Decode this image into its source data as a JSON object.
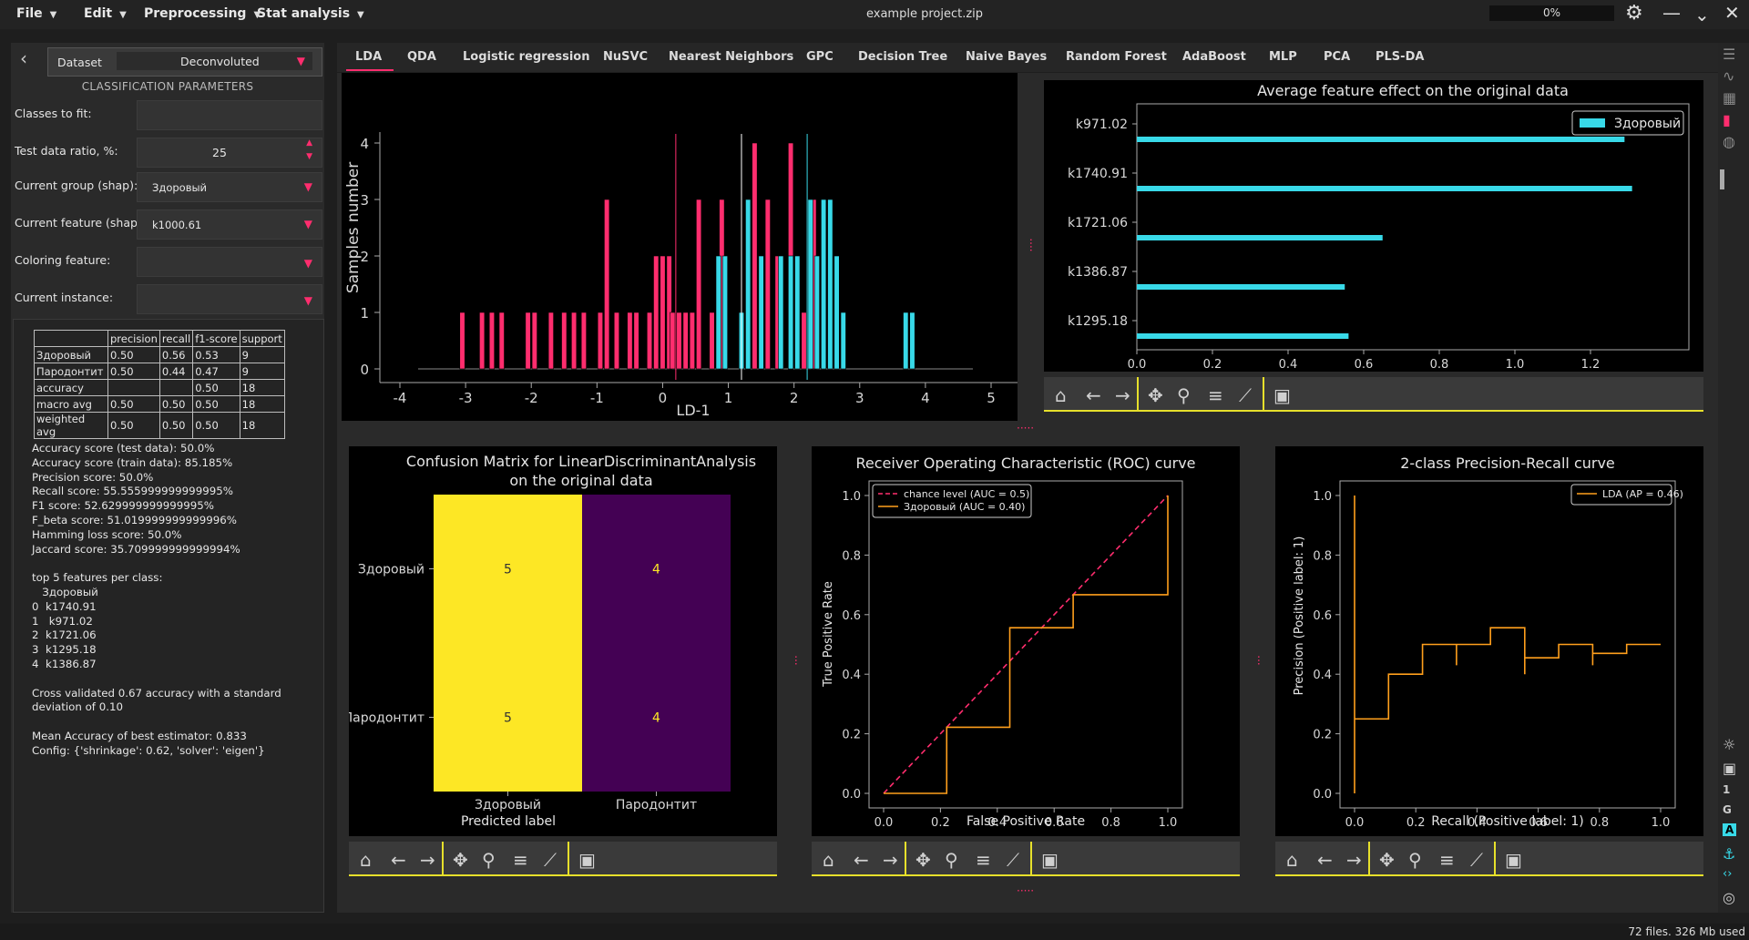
{
  "menu": {
    "file": "File",
    "edit": "Edit",
    "preprocessing": "Preprocessing",
    "stat": "Stat analysis"
  },
  "window_title": "example project.zip",
  "progress": "0%",
  "dataset": {
    "label": "Dataset",
    "value": "Deconvoluted"
  },
  "params_title": "CLASSIFICATION PARAMETERS",
  "params": [
    {
      "label": "Classes to fit:",
      "value": ""
    },
    {
      "label": "Test data ratio, %:",
      "value": "25"
    },
    {
      "label": "Current group (shap):",
      "value": "Здоровый"
    },
    {
      "label": "Current feature (shap):",
      "value": "k1000.61"
    },
    {
      "label": "Coloring feature:",
      "value": ""
    },
    {
      "label": "Current instance:",
      "value": ""
    }
  ],
  "report": {
    "header": [
      "",
      "precision",
      "recall",
      "f1-score",
      "support"
    ],
    "rows": [
      [
        "Здоровый",
        "0.50",
        "0.56",
        "0.53",
        "9"
      ],
      [
        "Пародонтит",
        "0.50",
        "0.44",
        "0.47",
        "9"
      ],
      [
        "accuracy",
        "",
        "",
        "0.50",
        "18"
      ],
      [
        " macro avg",
        "0.50",
        "0.50",
        "0.50",
        "18"
      ],
      [
        "weighted avg",
        "0.50",
        "0.50",
        "0.50",
        "18"
      ]
    ]
  },
  "metrics_text": "Accuracy score (test data): 50.0%\nAccuracy score (train data): 85.185%\nPrecision score: 50.0%\nRecall score: 55.555999999999995%\nF1 score: 52.629999999999995%\nF_beta score: 51.019999999999996%\nHamming loss score: 50.0%\nJaccard score: 35.709999999999994%\n\ntop 5 features per class:\n   Здоровый\n0  k1740.91\n1   k971.02\n2  k1721.06\n3  k1295.18\n4  k1386.87\n\nCross validated 0.67 accuracy with a standard\ndeviation of 0.10\n\nMean Accuracy of best estimator: 0.833\nConfig: {'shrinkage': 0.62, 'solver': 'eigen'}",
  "tabs": [
    "LDA",
    "QDA",
    "Logistic regression",
    "NuSVC",
    "Nearest Neighbors",
    "GPC",
    "Decision Tree",
    "Naive Bayes",
    "Random Forest",
    "AdaBoost",
    "MLP",
    "PCA",
    "PLS-DA"
  ],
  "status": "72 files. 326 Mb used",
  "colors": {
    "accent": "#ff2d6e",
    "pink": "#ff2d6e",
    "cyan": "#38d9e8",
    "yellow": "#fde725",
    "purple": "#440154",
    "orange": "#ff9f1c",
    "toolbar_line": "#e7e02b"
  },
  "toolbar_icons": [
    "home-icon",
    "back-arrow-icon",
    "forward-arrow-icon",
    "pan-icon",
    "zoom-icon",
    "configure-icon",
    "edit-axis-icon",
    "save-icon"
  ],
  "chart_data": [
    {
      "type": "bar",
      "title": "",
      "xlabel": "LD-1",
      "ylabel": "Samples number",
      "xlim": [
        -4,
        5
      ],
      "ylim": [
        0,
        4
      ],
      "xticks": [
        "-4",
        "-3",
        "-2",
        "-1",
        "0",
        "1",
        "2",
        "3",
        "4",
        "5"
      ],
      "yticks": [
        "0",
        "1",
        "2",
        "3",
        "4"
      ],
      "series": [
        {
          "color": "#ff2d6e",
          "bins": [
            [
              -3.05,
              1
            ],
            [
              -2.75,
              1
            ],
            [
              -2.6,
              1
            ],
            [
              -2.45,
              1
            ],
            [
              -2.05,
              1
            ],
            [
              -1.95,
              1
            ],
            [
              -1.7,
              1
            ],
            [
              -1.5,
              1
            ],
            [
              -1.35,
              1
            ],
            [
              -1.2,
              1
            ],
            [
              -0.95,
              1
            ],
            [
              -0.85,
              3
            ],
            [
              -0.7,
              1
            ],
            [
              -0.5,
              1
            ],
            [
              -0.4,
              1
            ],
            [
              -0.2,
              1
            ],
            [
              -0.1,
              2
            ],
            [
              0.0,
              2
            ],
            [
              0.1,
              2
            ],
            [
              0.15,
              1
            ],
            [
              0.25,
              1
            ],
            [
              0.35,
              1
            ],
            [
              0.45,
              1
            ],
            [
              0.55,
              3
            ],
            [
              0.75,
              1
            ],
            [
              0.9,
              3
            ],
            [
              1.3,
              2
            ],
            [
              1.4,
              4
            ],
            [
              1.5,
              1
            ],
            [
              1.6,
              3
            ],
            [
              1.75,
              2
            ],
            [
              1.95,
              4
            ],
            [
              2.15,
              1
            ],
            [
              2.3,
              3
            ]
          ]
        },
        {
          "color": "#38d9e8",
          "bins": [
            [
              0.85,
              2
            ],
            [
              0.95,
              2
            ],
            [
              1.2,
              1
            ],
            [
              1.3,
              3
            ],
            [
              1.5,
              2
            ],
            [
              1.8,
              2
            ],
            [
              1.95,
              2
            ],
            [
              2.05,
              2
            ],
            [
              2.25,
              3
            ],
            [
              2.35,
              2
            ],
            [
              2.45,
              3
            ],
            [
              2.55,
              3
            ],
            [
              2.65,
              2
            ],
            [
              2.75,
              1
            ],
            [
              3.7,
              1
            ],
            [
              3.8,
              1
            ]
          ]
        }
      ],
      "vlines": [
        {
          "x": 0.2,
          "color": "#ff2d6e"
        },
        {
          "x": 1.2,
          "color": "#ffffff"
        },
        {
          "x": 2.2,
          "color": "#38d9e8"
        }
      ]
    },
    {
      "type": "bar",
      "orientation": "horizontal",
      "title": "Average feature effect on the original data",
      "categories": [
        "k971.02",
        "k1740.91",
        "k1721.06",
        "k1386.87",
        "k1295.18"
      ],
      "values": [
        1.29,
        1.31,
        0.65,
        0.55,
        0.56
      ],
      "xlim": [
        0,
        1.4
      ],
      "xticks": [
        "0.0",
        "0.2",
        "0.4",
        "0.6",
        "0.8",
        "1.0",
        "1.2"
      ],
      "legend": "Здоровый",
      "legend_position": "top-right"
    },
    {
      "type": "heatmap",
      "title": "Confusion Matrix for LinearDiscriminantAnalysis\non the original data",
      "xlabel": "Predicted label",
      "categories": [
        "Здоровый",
        "Пародонтит"
      ],
      "matrix": [
        [
          5,
          4
        ],
        [
          5,
          4
        ]
      ]
    },
    {
      "type": "line",
      "title": "Receiver Operating Characteristic (ROC) curve",
      "xlabel": "False Positive Rate",
      "ylabel": "True Positive Rate",
      "xlim": [
        0,
        1
      ],
      "ylim": [
        0,
        1
      ],
      "ticks": [
        "0.0",
        "0.2",
        "0.4",
        "0.6",
        "0.8",
        "1.0"
      ],
      "series": [
        {
          "name": "chance level (AUC = 0.5)",
          "style": "dashed",
          "color": "#ff2d6e",
          "x": [
            0,
            1
          ],
          "y": [
            0,
            1
          ]
        },
        {
          "name": "Здоровый (AUC = 0.40)",
          "color": "#ff9f1c",
          "x": [
            0,
            0.222,
            0.222,
            0.444,
            0.444,
            0.667,
            0.667,
            1,
            1
          ],
          "y": [
            0,
            0,
            0.222,
            0.222,
            0.556,
            0.556,
            0.667,
            0.667,
            1
          ]
        }
      ],
      "legend_position": "top-left"
    },
    {
      "type": "line",
      "title": "2-class Precision-Recall curve",
      "xlabel": "Recall (Positive label: 1)",
      "ylabel": "Precision (Positive label: 1)",
      "xlim": [
        0,
        1
      ],
      "ylim": [
        0,
        1
      ],
      "ticks": [
        "0.0",
        "0.2",
        "0.4",
        "0.6",
        "0.8",
        "1.0"
      ],
      "series": [
        {
          "name": "LDA (AP = 0.46)",
          "color": "#ff9f1c",
          "x": [
            0,
            0,
            0,
            0.111,
            0.111,
            0.222,
            0.222,
            0.333,
            0.333,
            0.333,
            0.444,
            0.444,
            0.556,
            0.556,
            0.556,
            0.667,
            0.667,
            0.778,
            0.778,
            0.778,
            0.889,
            0.889,
            1.0
          ],
          "y": [
            0,
            1,
            0.25,
            0.25,
            0.4,
            0.4,
            0.5,
            0.5,
            0.43,
            0.5,
            0.5,
            0.556,
            0.556,
            0.4,
            0.455,
            0.455,
            0.5,
            0.5,
            0.43,
            0.47,
            0.47,
            0.5,
            0.5
          ]
        }
      ],
      "legend_position": "top-right"
    }
  ]
}
